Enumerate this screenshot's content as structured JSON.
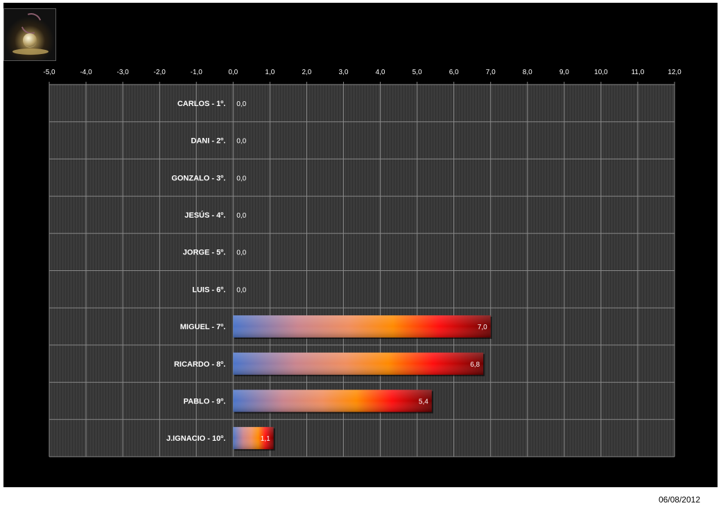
{
  "chart_data": {
    "type": "bar",
    "orientation": "horizontal",
    "categories": [
      "CARLOS - 1º.",
      "DANI - 2º.",
      "GONZALO - 3º.",
      "JESÚS - 4º.",
      "JORGE - 5º.",
      "LUIS - 6º.",
      "MIGUEL - 7º.",
      "RICARDO - 8º.",
      "PABLO - 9º.",
      "J.IGNACIO - 10º."
    ],
    "values": [
      0.0,
      0.0,
      0.0,
      0.0,
      0.0,
      0.0,
      7.0,
      6.8,
      5.4,
      1.1
    ],
    "value_labels": [
      "0,0",
      "0,0",
      "0,0",
      "0,0",
      "0,0",
      "0,0",
      "7,0",
      "6,8",
      "5,4",
      "1,1"
    ],
    "x_ticks": [
      "-5,0",
      "-4,0",
      "-3,0",
      "-2,0",
      "-1,0",
      "0,0",
      "1,0",
      "2,0",
      "3,0",
      "4,0",
      "5,0",
      "6,0",
      "7,0",
      "8,0",
      "9,0",
      "10,0",
      "11,0",
      "12,0"
    ],
    "xlim": [
      -5,
      12
    ],
    "grid": true,
    "legend": "none",
    "colors": {
      "background": "#000000",
      "plot_area": "#3a3a3a",
      "grid": "#8a8a8a",
      "text": "#ffffff",
      "bar_gradient": [
        "#4a74c9",
        "#c9848e",
        "#f08e5e",
        "#ff8a00",
        "#ff0d0d",
        "#6e0000"
      ]
    }
  },
  "footer": {
    "date": "06/08/2012"
  },
  "logo": {
    "icon": "crystal-ball-icon"
  }
}
